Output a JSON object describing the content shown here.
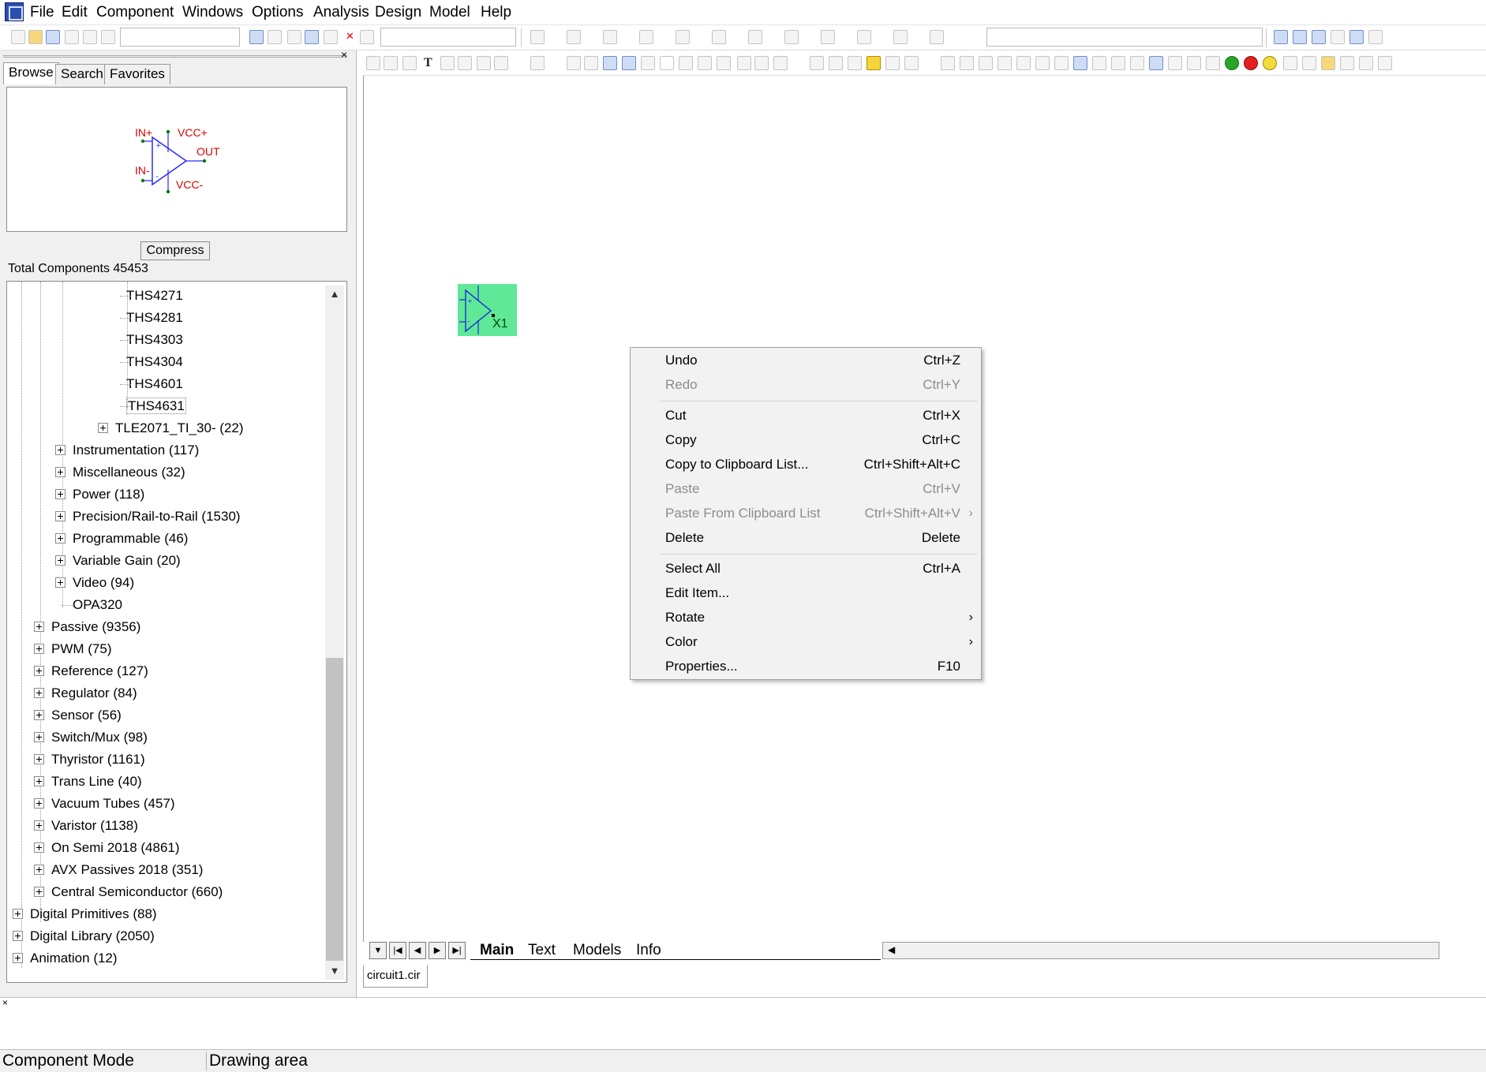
{
  "menubar": {
    "items": [
      "File",
      "Edit",
      "Component",
      "Windows",
      "Options",
      "Analysis",
      "Design",
      "Model",
      "Help"
    ]
  },
  "left_panel": {
    "tabs": [
      "Browse",
      "Search",
      "Favorites"
    ],
    "close_glyph": "×",
    "compress_label": "Compress",
    "total_components": "Total Components 45453",
    "preview": {
      "pins": [
        "IN+",
        "VCC+",
        "OUT",
        "IN-",
        "VCC-"
      ]
    },
    "tree": [
      {
        "label": "THS4271"
      },
      {
        "label": "THS4281"
      },
      {
        "label": "THS4303"
      },
      {
        "label": "THS4304"
      },
      {
        "label": "THS4601"
      },
      {
        "label": "THS4631"
      },
      {
        "label": "TLE2071_TI_30- (22)"
      },
      {
        "label": "Instrumentation (117)"
      },
      {
        "label": "Miscellaneous (32)"
      },
      {
        "label": "Power (118)"
      },
      {
        "label": "Precision/Rail-to-Rail (1530)"
      },
      {
        "label": "Programmable (46)"
      },
      {
        "label": "Variable Gain (20)"
      },
      {
        "label": "Video (94)"
      },
      {
        "label": "OPA320"
      },
      {
        "label": "Passive (9356)"
      },
      {
        "label": "PWM (75)"
      },
      {
        "label": "Reference (127)"
      },
      {
        "label": "Regulator (84)"
      },
      {
        "label": "Sensor (56)"
      },
      {
        "label": "Switch/Mux (98)"
      },
      {
        "label": "Thyristor (1161)"
      },
      {
        "label": "Trans Line (40)"
      },
      {
        "label": "Vacuum Tubes (457)"
      },
      {
        "label": "Varistor (1138)"
      },
      {
        "label": "On Semi 2018 (4861)"
      },
      {
        "label": "AVX Passives 2018 (351)"
      },
      {
        "label": "Central Semiconductor (660)"
      },
      {
        "label": "Digital Primitives (88)"
      },
      {
        "label": "Digital Library (2050)"
      },
      {
        "label": "Animation (12)"
      }
    ]
  },
  "drawing": {
    "component_label": "X1",
    "component_color": "#5fe898"
  },
  "context_menu": {
    "items": [
      {
        "label": "Undo",
        "shortcut": "Ctrl+Z"
      },
      {
        "label": "Redo",
        "shortcut": "Ctrl+Y"
      },
      {
        "label": "Cut",
        "shortcut": "Ctrl+X"
      },
      {
        "label": "Copy",
        "shortcut": "Ctrl+C"
      },
      {
        "label": "Copy to Clipboard List...",
        "shortcut": "Ctrl+Shift+Alt+C"
      },
      {
        "label": "Paste",
        "shortcut": "Ctrl+V"
      },
      {
        "label": "Paste From Clipboard List",
        "shortcut": "Ctrl+Shift+Alt+V"
      },
      {
        "label": "Delete",
        "shortcut": "Delete"
      },
      {
        "label": "Select All",
        "shortcut": "Ctrl+A"
      },
      {
        "label": "Edit Item...",
        "shortcut": ""
      },
      {
        "label": "Rotate",
        "shortcut": ""
      },
      {
        "label": "Color",
        "shortcut": ""
      },
      {
        "label": "Properties...",
        "shortcut": "F10"
      }
    ]
  },
  "page_tabs": [
    "Main",
    "Text",
    "Models",
    "Info"
  ],
  "file_tab": "circuit1.cir",
  "output_close": "×",
  "status": {
    "mode": "Component Mode",
    "area": "Drawing area"
  }
}
